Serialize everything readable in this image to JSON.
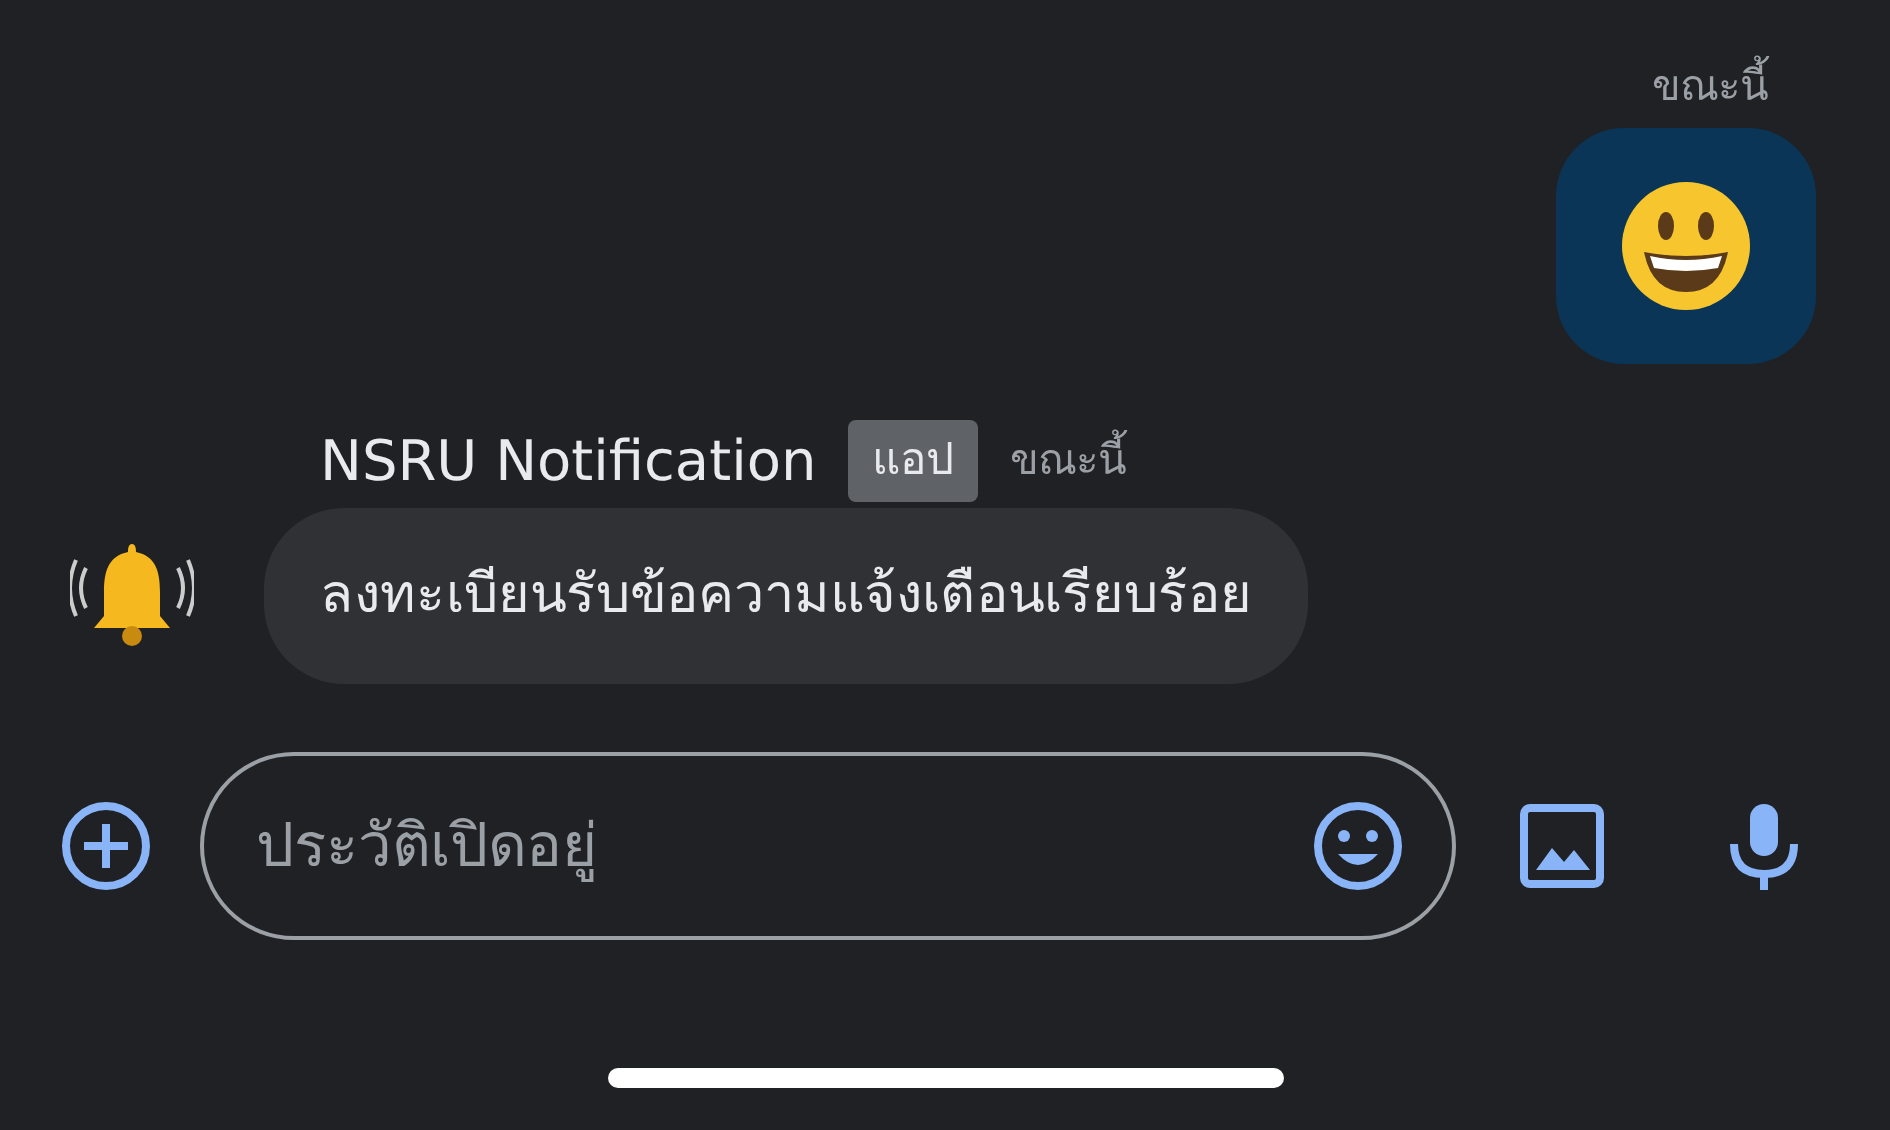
{
  "sent_message": {
    "time": "ขณะนี้"
  },
  "incoming_message": {
    "sender": "NSRU Notification",
    "badge": "แอป",
    "time": "ขณะนี้",
    "text": "ลงทะเบียนรับข้อความแจ้งเตือนเรียบร้อย"
  },
  "composer": {
    "placeholder": "ประวัติเปิดอยู่"
  }
}
